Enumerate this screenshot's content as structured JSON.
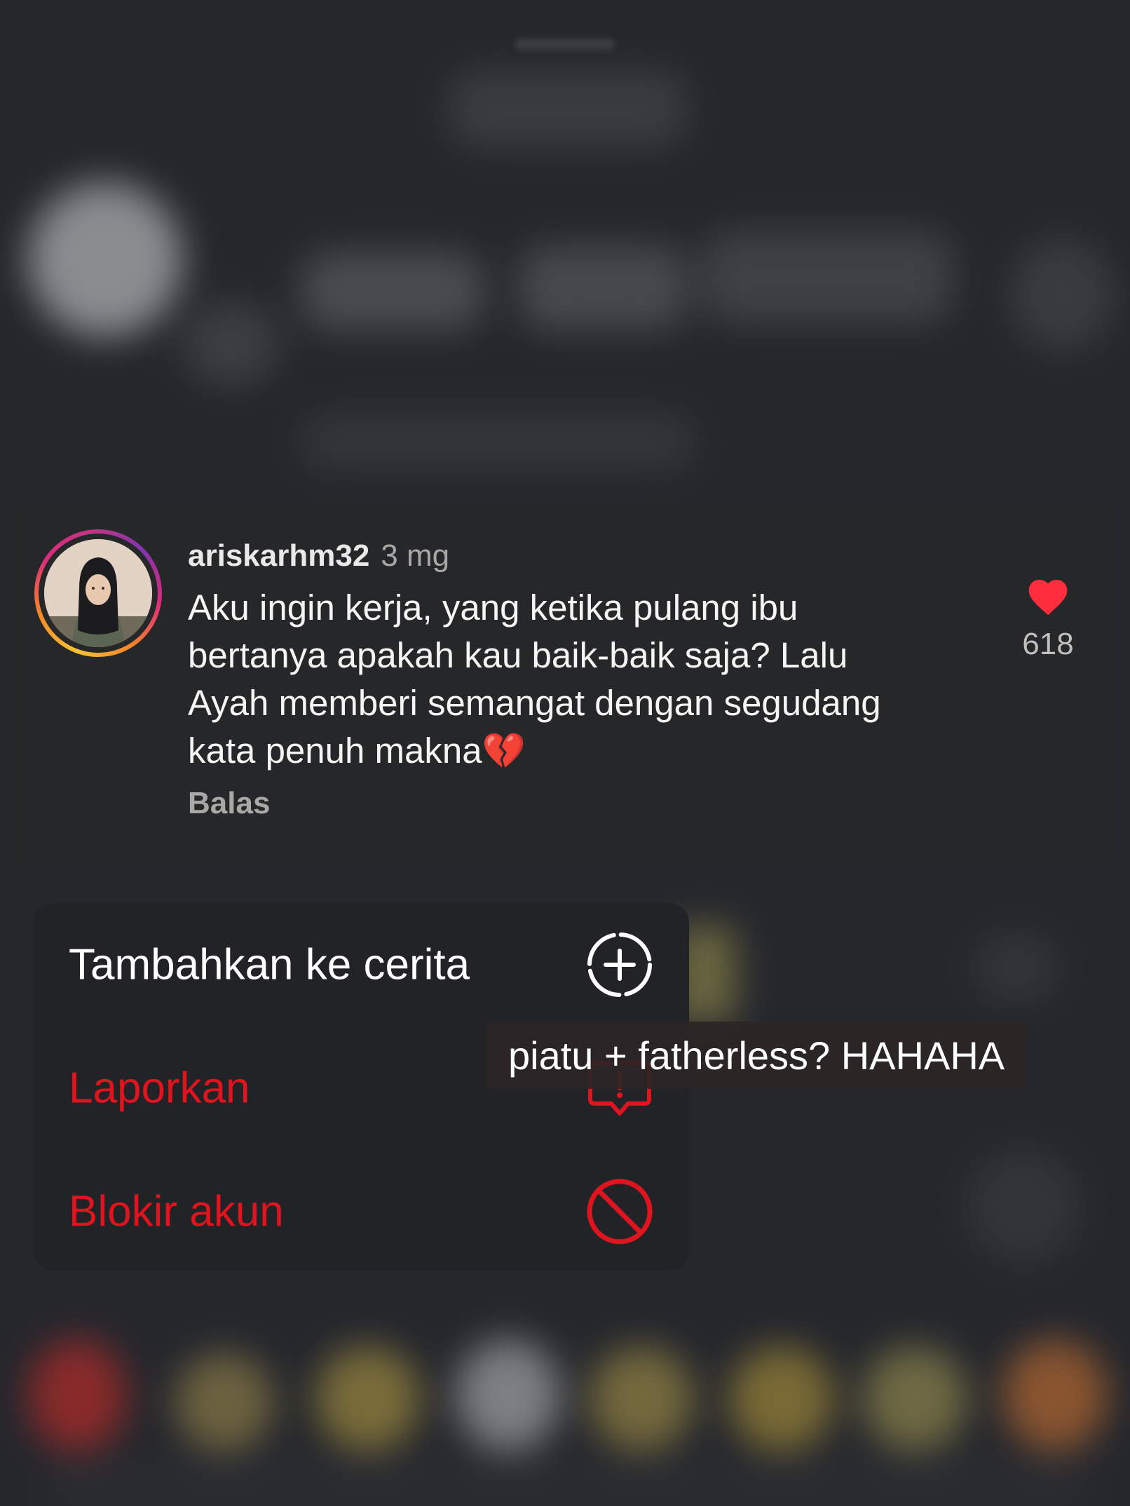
{
  "comment": {
    "username": "ariskarhm32",
    "timestamp": "3 mg",
    "text": "Aku ingin kerja, yang ketika pulang ibu bertanya apakah kau baik-baik saja? Lalu Ayah memberi semangat dengan segudang kata penuh makna",
    "emoji": "💔",
    "reply_label": "Balas",
    "like_count": "618",
    "like_icon": "heart-icon"
  },
  "menu": {
    "items": [
      {
        "label": "Tambahkan ke cerita",
        "icon": "add-circle-dashed-icon",
        "color": "#ffffff"
      },
      {
        "label": "Laporkan",
        "icon": "report-icon",
        "color": "#e0141e"
      },
      {
        "label": "Blokir akun",
        "icon": "block-icon",
        "color": "#e0141e"
      }
    ]
  },
  "overlay": {
    "caption": "piatu + fatherless? HAHAHA"
  },
  "colors": {
    "background": "#25272c",
    "card": "#262729",
    "menu": "#222327",
    "danger": "#e0141e",
    "heart": "#ff2d3d"
  }
}
